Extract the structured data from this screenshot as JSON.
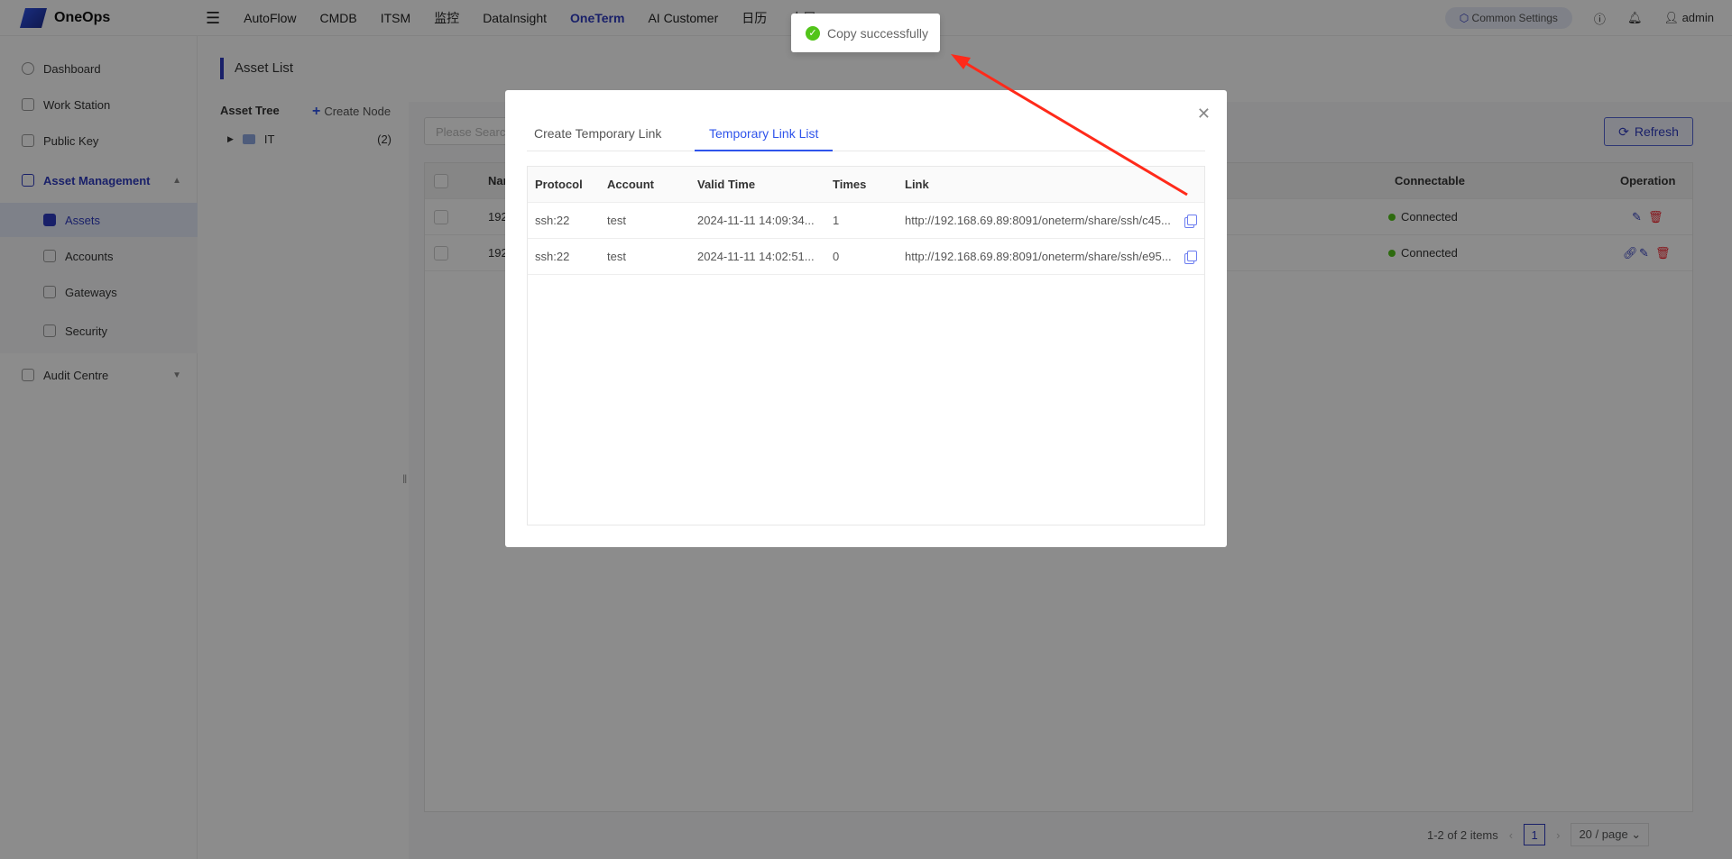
{
  "header": {
    "logo": "OneOps",
    "nav": [
      "AutoFlow",
      "CMDB",
      "ITSM",
      "监控",
      "DataInsight",
      "OneTerm",
      "AI Customer",
      "日历",
      "大屏"
    ],
    "active_nav": "OneTerm",
    "common_settings": "Common Settings",
    "user": "admin"
  },
  "sidebar": {
    "items": [
      {
        "label": "Dashboard"
      },
      {
        "label": "Work Station"
      },
      {
        "label": "Public Key"
      },
      {
        "label": "Asset Management"
      },
      {
        "label": "Assets"
      },
      {
        "label": "Accounts"
      },
      {
        "label": "Gateways"
      },
      {
        "label": "Security"
      },
      {
        "label": "Audit Centre"
      }
    ]
  },
  "main": {
    "title": "Asset List",
    "tree_title": "Asset Tree",
    "create_node": "Create Node",
    "tree": [
      {
        "label": "IT",
        "count": "(2)"
      }
    ],
    "search_placeholder": "Please Search",
    "refresh": "Refresh",
    "table": {
      "headers": [
        "Nam",
        "Connectable",
        "Operation"
      ],
      "rows": [
        {
          "name": "192",
          "status": "Connected"
        },
        {
          "name": "192",
          "status": "Connected"
        }
      ]
    },
    "pagination": {
      "summary": "1-2 of 2 items",
      "page": "1",
      "page_size": "20 / page"
    }
  },
  "modal": {
    "tabs": [
      "Create Temporary Link",
      "Temporary Link List"
    ],
    "active_tab": "Temporary Link List",
    "headers": [
      "Protocol",
      "Account",
      "Valid Time",
      "Times",
      "Link"
    ],
    "rows": [
      [
        "ssh:22",
        "test",
        "2024-11-11 14:09:34...",
        "1",
        "http://192.168.69.89:8091/oneterm/share/ssh/c45..."
      ],
      [
        "ssh:22",
        "test",
        "2024-11-11 14:02:51...",
        "0",
        "http://192.168.69.89:8091/oneterm/share/ssh/e95..."
      ]
    ]
  },
  "toast": {
    "message": "Copy successfully"
  },
  "colors": {
    "accent": "#2f3bbf",
    "success": "#52c41a",
    "danger": "#f5222d",
    "annotation_arrow": "#ff2a1a"
  }
}
